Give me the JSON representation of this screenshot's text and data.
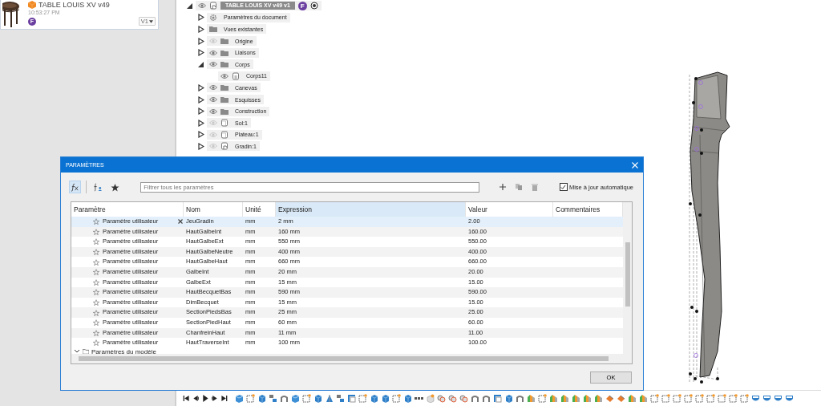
{
  "document_card": {
    "title": "TABLE LOUIS XV v49",
    "time": "10:53:27 PM",
    "avatar": "F",
    "version": "V1"
  },
  "browser": {
    "root": {
      "label": "TABLE LOUIS XV v49 v1",
      "badge": "F",
      "expanded": true
    },
    "items": [
      {
        "label": "Paramètres du document",
        "kind": "gear",
        "expanded": false
      },
      {
        "label": "Vues existantes",
        "kind": "folder",
        "expanded": false
      },
      {
        "label": "Origine",
        "kind": "folder",
        "expanded": false,
        "visible": false
      },
      {
        "label": "Liaisons",
        "kind": "folder",
        "expanded": false,
        "visible": true
      },
      {
        "label": "Corps",
        "kind": "folder",
        "expanded": true,
        "visible": true,
        "children": [
          {
            "label": "Corps11",
            "kind": "body",
            "visible": true
          }
        ]
      },
      {
        "label": "Canevas",
        "kind": "folder",
        "expanded": false,
        "visible": true
      },
      {
        "label": "Esquisses",
        "kind": "folder",
        "expanded": false,
        "visible": true
      },
      {
        "label": "Construction",
        "kind": "folder",
        "expanded": false,
        "visible": true
      },
      {
        "label": "Sol:1",
        "kind": "component",
        "expanded": false,
        "visible": false
      },
      {
        "label": "Plateau:1",
        "kind": "component",
        "expanded": false,
        "visible": false
      },
      {
        "label": "Gradin:1",
        "kind": "linked",
        "expanded": false,
        "visible": false
      }
    ]
  },
  "dialog": {
    "title": "PARAMÈTRES",
    "filter_placeholder": "Filtrer tous les paramètres",
    "auto_update": {
      "label": "Mise à jour automatique",
      "checked": true
    },
    "tools": [
      {
        "kind": "fx",
        "selected": true
      },
      {
        "kind": "user",
        "selected": false
      },
      {
        "kind": "star",
        "selected": false
      }
    ],
    "columns": [
      {
        "label": "Paramètre",
        "sorted": false
      },
      {
        "label": "Nom",
        "sorted": false
      },
      {
        "label": "Unité",
        "sorted": false
      },
      {
        "label": "Expression",
        "sorted": true
      },
      {
        "label": "Valeur",
        "sorted": false
      },
      {
        "label": "Commentaires",
        "sorted": false
      }
    ],
    "rows": [
      {
        "type": "Paramètre utilisateur",
        "name": "JeuGradin",
        "unit": "mm",
        "expression": "2 mm",
        "value": "2.00",
        "favorite": false,
        "selected": true
      },
      {
        "type": "Paramètre utilisateur",
        "name": "HautGalbeInt",
        "unit": "mm",
        "expression": "160 mm",
        "value": "160.00",
        "favorite": false,
        "selected": false
      },
      {
        "type": "Paramètre utilisateur",
        "name": "HautGalbeExt",
        "unit": "mm",
        "expression": "550 mm",
        "value": "550.00",
        "favorite": false,
        "selected": false
      },
      {
        "type": "Paramètre utilisateur",
        "name": "HautGalbeNeutre",
        "unit": "mm",
        "expression": "400 mm",
        "value": "400.00",
        "favorite": false,
        "selected": false
      },
      {
        "type": "Paramètre utilisateur",
        "name": "HautGalbeHaut",
        "unit": "mm",
        "expression": "660 mm",
        "value": "660.00",
        "favorite": false,
        "selected": false
      },
      {
        "type": "Paramètre utilisateur",
        "name": "GalbeInt",
        "unit": "mm",
        "expression": "20 mm",
        "value": "20.00",
        "favorite": false,
        "selected": false
      },
      {
        "type": "Paramètre utilisateur",
        "name": "GalbeExt",
        "unit": "mm",
        "expression": "15 mm",
        "value": "15.00",
        "favorite": false,
        "selected": false
      },
      {
        "type": "Paramètre utilisateur",
        "name": "HautBecquetBas",
        "unit": "mm",
        "expression": "590 mm",
        "value": "590.00",
        "favorite": false,
        "selected": false
      },
      {
        "type": "Paramètre utilisateur",
        "name": "DimBecquet",
        "unit": "mm",
        "expression": "15 mm",
        "value": "15.00",
        "favorite": false,
        "selected": false
      },
      {
        "type": "Paramètre utilisateur",
        "name": "SectionPiedsBas",
        "unit": "mm",
        "expression": "25 mm",
        "value": "25.00",
        "favorite": false,
        "selected": false
      },
      {
        "type": "Paramètre utilisateur",
        "name": "SectionPiedHaut",
        "unit": "mm",
        "expression": "60 mm",
        "value": "60.00",
        "favorite": false,
        "selected": false
      },
      {
        "type": "Paramètre utilisateur",
        "name": "ChanfreinHaut",
        "unit": "mm",
        "expression": "11 mm",
        "value": "11.00",
        "favorite": false,
        "selected": false
      },
      {
        "type": "Paramètre utilisateur",
        "name": "HautTraverseInt",
        "unit": "mm",
        "expression": "100 mm",
        "value": "100.00",
        "favorite": false,
        "selected": false
      }
    ],
    "group": {
      "label": "Paramètres du modèle",
      "expanded": true
    },
    "ok": "OK"
  },
  "timeline": {
    "features": [
      {
        "kind": "plane"
      },
      {
        "kind": "sketch"
      },
      {
        "kind": "extrude"
      },
      {
        "kind": "joint"
      },
      {
        "kind": "loft"
      },
      {
        "kind": "plane"
      },
      {
        "kind": "sketch"
      },
      {
        "kind": "extrude"
      },
      {
        "kind": "draft"
      },
      {
        "kind": "joint"
      },
      {
        "kind": "corner"
      },
      {
        "kind": "sketch"
      },
      {
        "kind": "extrude"
      },
      {
        "kind": "extrude"
      },
      {
        "kind": "sketch"
      },
      {
        "kind": "extrude"
      },
      {
        "kind": "pattern"
      },
      {
        "kind": "hole"
      },
      {
        "kind": "combine"
      },
      {
        "kind": "combine"
      },
      {
        "kind": "combine"
      },
      {
        "kind": "loft"
      },
      {
        "kind": "loft"
      },
      {
        "kind": "corner"
      },
      {
        "kind": "extrude"
      },
      {
        "kind": "loft"
      },
      {
        "kind": "fillet"
      },
      {
        "kind": "sketch"
      },
      {
        "kind": "fillet"
      },
      {
        "kind": "fillet"
      },
      {
        "kind": "fillet"
      },
      {
        "kind": "fillet"
      },
      {
        "kind": "fillet"
      },
      {
        "kind": "chamfer"
      },
      {
        "kind": "chamfer"
      },
      {
        "kind": "fillet"
      },
      {
        "kind": "fillet"
      },
      {
        "kind": "sketch"
      },
      {
        "kind": "sketch"
      },
      {
        "kind": "sketch"
      },
      {
        "kind": "sketch"
      },
      {
        "kind": "sketch"
      },
      {
        "kind": "sketch"
      },
      {
        "kind": "sketch"
      },
      {
        "kind": "sketch"
      },
      {
        "kind": "sketch"
      },
      {
        "kind": "mirror"
      },
      {
        "kind": "mirror"
      },
      {
        "kind": "mirror"
      },
      {
        "kind": "mirror"
      }
    ]
  }
}
